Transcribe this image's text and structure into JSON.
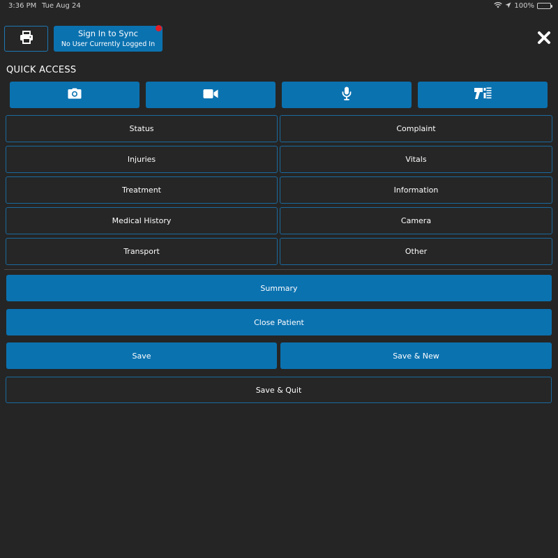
{
  "status_bar": {
    "time": "3:36 PM",
    "date": "Tue Aug 24",
    "battery": "100%",
    "icons": [
      "wifi-icon",
      "location-arrow-icon",
      "battery-icon"
    ]
  },
  "header": {
    "print_icon": "printer-icon",
    "sync_title": "Sign In to Sync",
    "sync_subtitle": "No User Currently Logged In",
    "close_icon": "close-x-icon"
  },
  "quick_access": {
    "title": "QUICK ACCESS",
    "buttons": [
      {
        "icon": "camera-icon"
      },
      {
        "icon": "video-camera-icon"
      },
      {
        "icon": "microphone-icon"
      },
      {
        "icon": "barcode-scanner-icon"
      }
    ]
  },
  "categories": [
    "Status",
    "Complaint",
    "Injuries",
    "Vitals",
    "Treatment",
    "Information",
    "Medical History",
    "Camera",
    "Transport",
    "Other"
  ],
  "actions": {
    "summary": "Summary",
    "close_patient": "Close Patient",
    "save": "Save",
    "save_new": "Save & New",
    "save_quit": "Save & Quit"
  },
  "colors": {
    "background": "#252525",
    "primary_blue": "#0b72b0",
    "border_blue": "#1a6a9f",
    "notification_red": "#e31b23"
  }
}
